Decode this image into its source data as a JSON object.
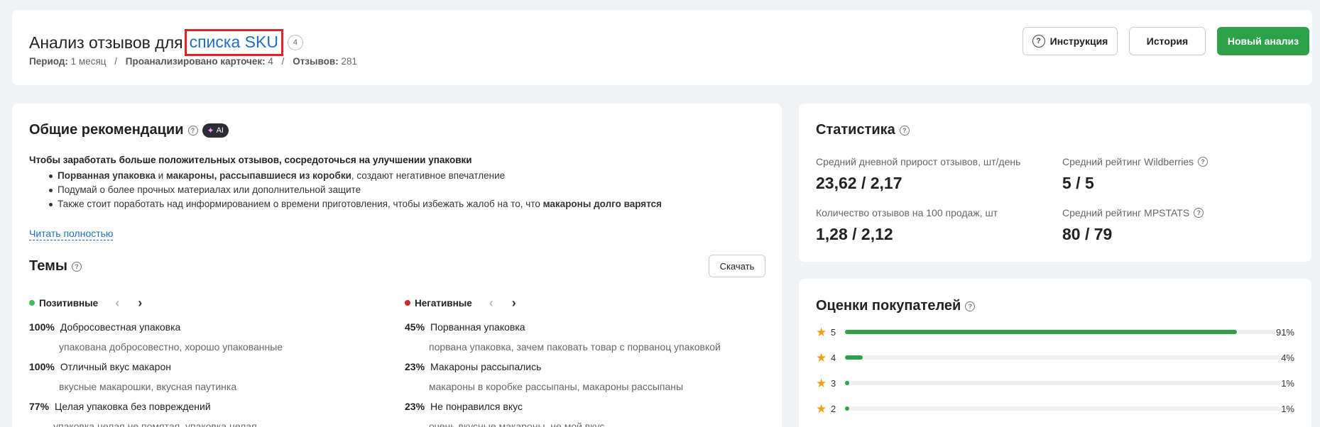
{
  "header": {
    "title_prefix": "Анализ отзывов для",
    "title_link": "списка SKU",
    "sku_count": "4",
    "meta": [
      {
        "label": "Период:",
        "value": "1 месяц"
      },
      {
        "label": "Проанализировано карточек:",
        "value": "4"
      },
      {
        "label": "Отзывов:",
        "value": "281"
      }
    ],
    "meta_separator": "/",
    "buttons": {
      "instruction": "Инструкция",
      "history": "История",
      "new_analysis": "Новый анализ"
    }
  },
  "recommendations": {
    "title": "Общие рекомендации",
    "ai_label": "AI",
    "main": "Чтобы заработать больше положительных отзывов, сосредоточься на улучшении упаковки",
    "items": [
      {
        "b1": "Порванная упаковка",
        "t1": " и ",
        "b2": "макароны, рассыпавшиеся из коробки",
        "t2": ", создают негативное впечатление"
      },
      {
        "b1": "",
        "t1": "Подумай о более прочных материалах или дополнительной защите",
        "b2": "",
        "t2": ""
      },
      {
        "b1": "",
        "t1": "Также стоит поработать над информированием о времени приготовления, чтобы избежать жалоб на то, что ",
        "b2": "макароны долго варятся",
        "t2": ""
      }
    ],
    "read_more": "Читать полностью"
  },
  "topics": {
    "title": "Темы",
    "download": "Скачать",
    "positive": {
      "label": "Позитивные",
      "color": "#3bbf5a",
      "items": [
        {
          "pct": "100%",
          "name": "Добросовестная упаковка",
          "sub": "упакована добросовестно, хорошо упакованные"
        },
        {
          "pct": "100%",
          "name": "Отличный вкус макарон",
          "sub": "вкусные макарошки, вкусная паутинка"
        },
        {
          "pct": "77%",
          "name": "Целая упаковка без повреждений",
          "sub": "упаковка целая не помятая, упаковка целая"
        }
      ]
    },
    "negative": {
      "label": "Негативные",
      "color": "#e0242b",
      "items": [
        {
          "pct": "45%",
          "name": "Порванная упаковка",
          "sub": "порвана упаковка, зачем паковать товар с порваноц упаковкой"
        },
        {
          "pct": "23%",
          "name": "Макароны рассыпались",
          "sub": "макароны в коробке рассыпаны, макароны рассыпаны"
        },
        {
          "pct": "23%",
          "name": "Не понравился вкус",
          "sub": "очень вкусные макароны, не мой вкус"
        }
      ]
    }
  },
  "statistics": {
    "title": "Статистика",
    "items": [
      {
        "label": "Средний дневной прирост отзывов, шт/день",
        "value": "23,62 / 2,17",
        "help": false
      },
      {
        "label": "Средний рейтинг Wildberries",
        "value": "5 / 5",
        "help": true
      },
      {
        "label": "Количество отзывов на 100 продаж, шт",
        "value": "1,28 / 2,12",
        "help": false
      },
      {
        "label": "Средний рейтинг MPSTATS",
        "value": "80 / 79",
        "help": true
      }
    ]
  },
  "ratings": {
    "title": "Оценки покупателей",
    "bar_color": "#2ea24b",
    "star_color": "#f0a11a",
    "items": [
      {
        "stars": "5",
        "pct": "91%",
        "fraction": 0.91
      },
      {
        "stars": "4",
        "pct": "4%",
        "fraction": 0.04
      },
      {
        "stars": "3",
        "pct": "1%",
        "fraction": 0.01
      },
      {
        "stars": "2",
        "pct": "1%",
        "fraction": 0.01
      }
    ]
  }
}
